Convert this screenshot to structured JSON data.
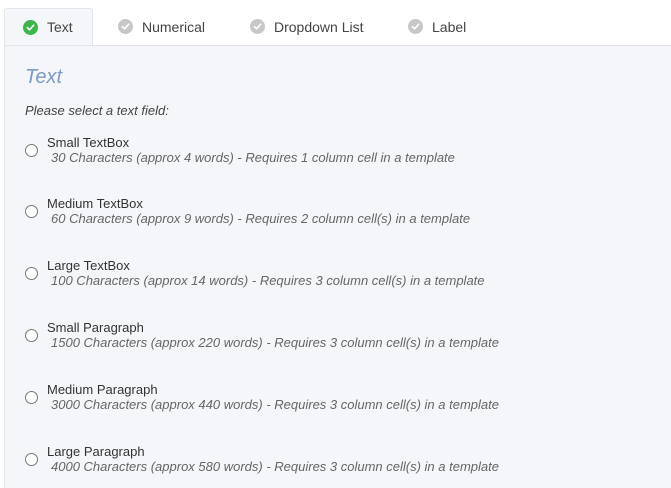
{
  "tabs": [
    {
      "label": "Text",
      "active": true
    },
    {
      "label": "Numerical",
      "active": false
    },
    {
      "label": "Dropdown List",
      "active": false
    },
    {
      "label": "Label",
      "active": false
    }
  ],
  "section": {
    "title": "Text",
    "prompt": "Please select a text field:"
  },
  "options": [
    {
      "label": "Small TextBox",
      "description": "30 Characters (approx 4 words) - Requires 1 column cell in a template"
    },
    {
      "label": "Medium TextBox",
      "description": "60 Characters (approx 9 words) - Requires 2 column cell(s) in a template"
    },
    {
      "label": "Large TextBox",
      "description": "100 Characters (approx 14 words) - Requires 3 column cell(s) in a template"
    },
    {
      "label": "Small Paragraph",
      "description": "1500 Characters (approx 220 words) - Requires 3 column cell(s) in a template"
    },
    {
      "label": "Medium Paragraph",
      "description": "3000 Characters (approx 440 words) - Requires 3 column cell(s) in a template"
    },
    {
      "label": "Large Paragraph",
      "description": "4000 Characters (approx 580 words) - Requires 3 column cell(s) in a template"
    }
  ],
  "colors": {
    "active_check": "#3cb54a",
    "inactive_check": "#c7c7c7",
    "title": "#7d9ac4",
    "panel_bg": "#f4f6f9"
  },
  "icons": {
    "tab_check": "check-circle-icon",
    "radio": "radio-empty"
  }
}
